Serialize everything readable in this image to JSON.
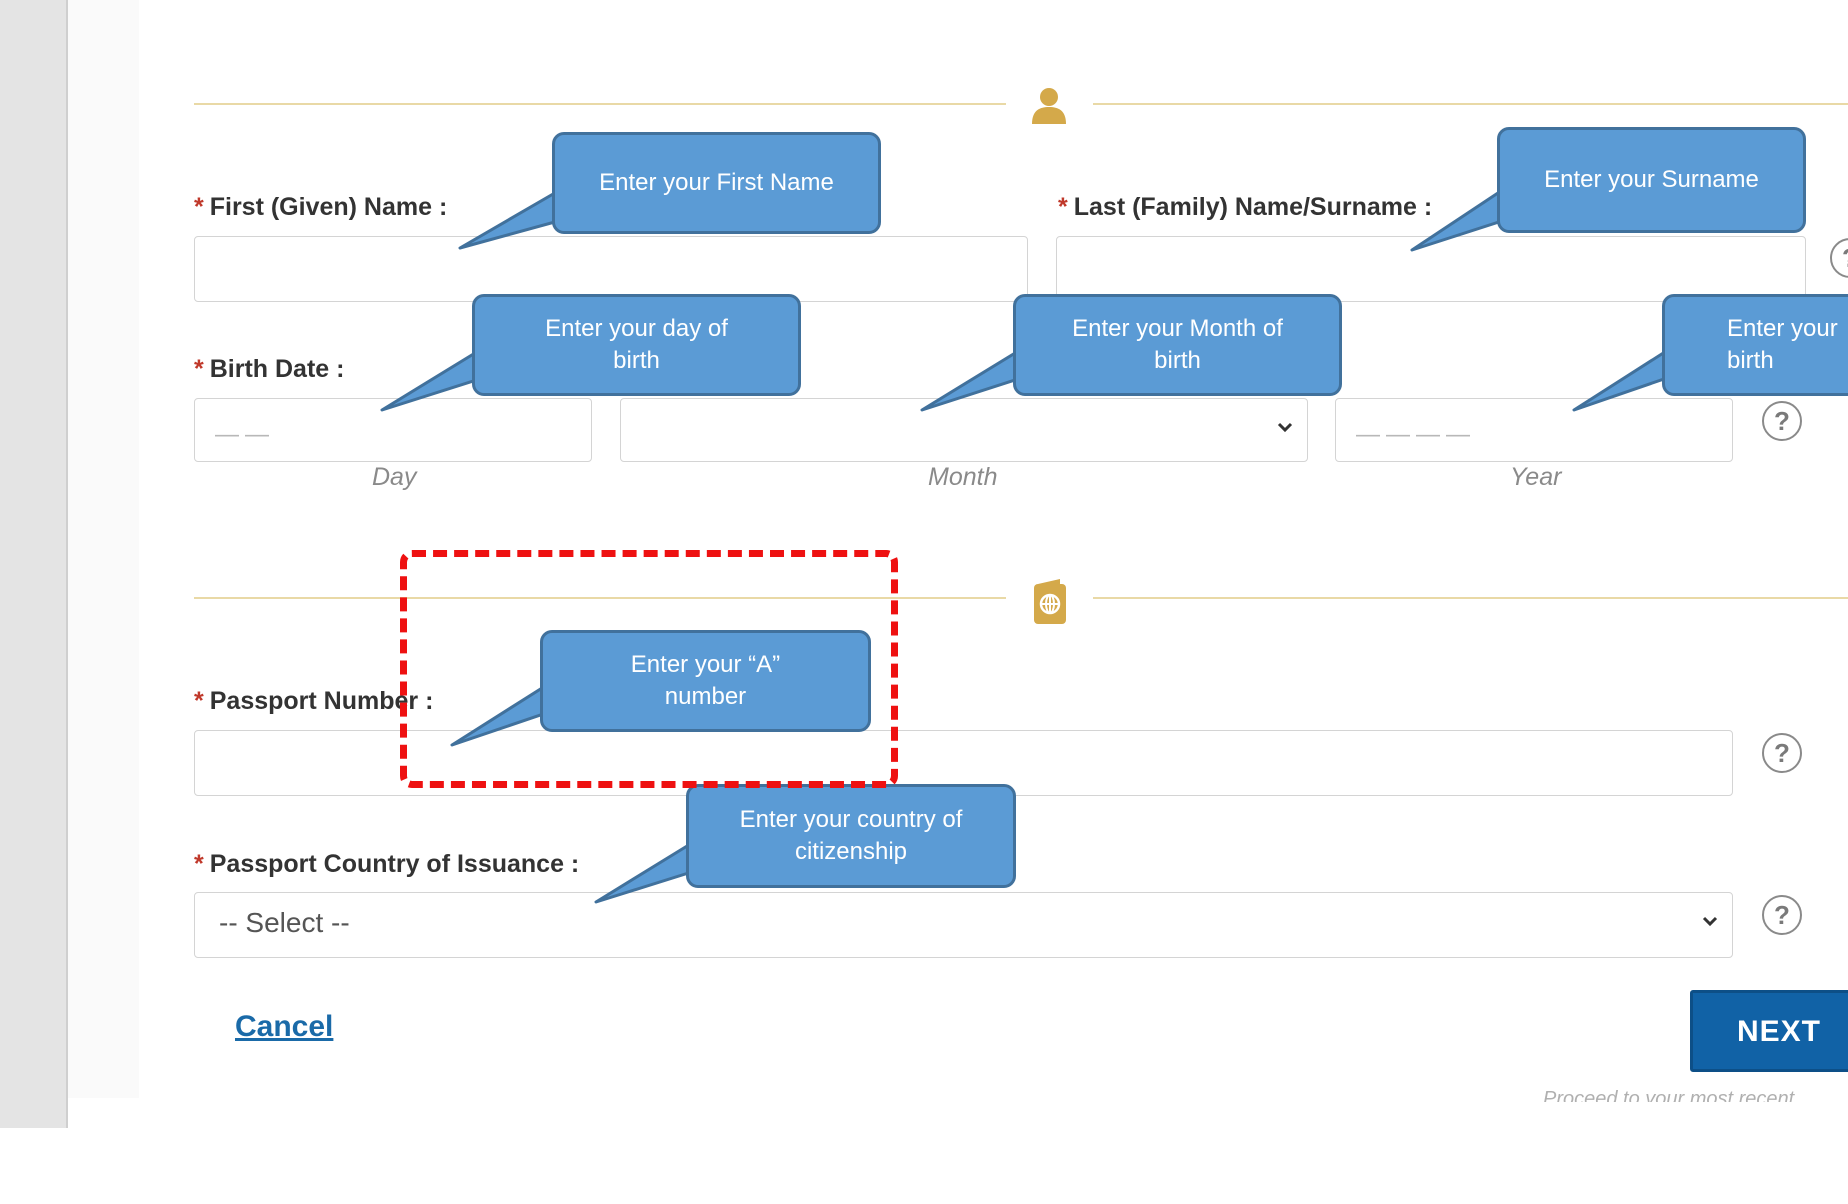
{
  "header": {
    "cut_off_text": ""
  },
  "personal": {
    "first_name_label": "First (Given) Name :",
    "last_name_label": "Last (Family) Name/Surname :",
    "birth_date_label": "Birth Date :",
    "day_placeholder": "——",
    "year_placeholder": "————",
    "day_caption": "Day",
    "month_caption": "Month",
    "year_caption": "Year"
  },
  "passport": {
    "number_label": "Passport Number :",
    "country_label": "Passport Country of Issuance :",
    "country_value": "-- Select --"
  },
  "actions": {
    "cancel_label": "Cancel",
    "next_label": "NEXT",
    "proceed_text": "Proceed to your most recent"
  },
  "help_glyph": "?",
  "required_marker": "*",
  "callouts": {
    "first_name": "Enter your  First Name",
    "surname": "Enter your  Surname",
    "day": "Enter your  day of\nbirth",
    "month": "Enter your Month of\nbirth",
    "year": "Enter your\nbirth",
    "a_number": "Enter your  “A”\nnumber",
    "country": "Enter your  country of\ncitizenship"
  },
  "colors": {
    "accent_gold": "#d4a94a",
    "divider": "#e9d9a6",
    "callout_fill": "#5b9bd5",
    "callout_border": "#41719c",
    "next_button": "#1162a6",
    "required": "#c0392b",
    "highlight": "#ee1111"
  },
  "icons": [
    "person-icon",
    "passport-icon",
    "help-icon",
    "chevron-down-icon"
  ]
}
